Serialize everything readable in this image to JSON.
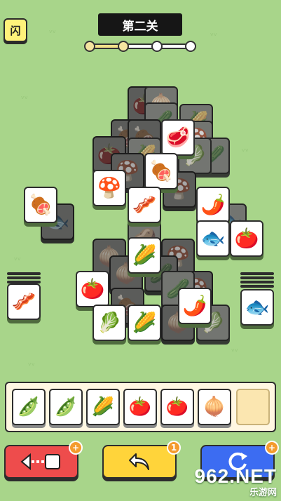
{
  "header": {
    "level_title": "第二关",
    "hint_label": "闪",
    "progress_steps_done": 2,
    "progress_steps_total": 4
  },
  "tiles": {
    "active": [
      {
        "id": "meat-top",
        "icon": "🥩",
        "name": "meat"
      },
      {
        "id": "ham-top",
        "icon": "🍖",
        "name": "ham"
      },
      {
        "id": "mushroom",
        "icon": "🍄",
        "name": "mushroom"
      },
      {
        "id": "ham-left",
        "icon": "🍖",
        "name": "ham"
      },
      {
        "id": "meat-center",
        "icon": "🥓",
        "name": "bacon"
      },
      {
        "id": "chili-right",
        "icon": "🌶️",
        "name": "chili"
      },
      {
        "id": "fish-center",
        "icon": "🐟",
        "name": "fish"
      },
      {
        "id": "tomato-right",
        "icon": "🍅",
        "name": "tomato"
      },
      {
        "id": "bamboo-center",
        "icon": "🌽",
        "name": "bamboo-shoot"
      },
      {
        "id": "tomato-left",
        "icon": "🍅",
        "name": "tomato"
      },
      {
        "id": "chili-bottom",
        "icon": "🌶️",
        "name": "chili"
      },
      {
        "id": "celery",
        "icon": "🥬",
        "name": "celery"
      },
      {
        "id": "bamboo-bottom",
        "icon": "🌽",
        "name": "bamboo-shoot"
      },
      {
        "id": "bacon-left-stack",
        "icon": "🥓",
        "name": "bacon"
      },
      {
        "id": "fish-right-stack",
        "icon": "🐟",
        "name": "fish"
      }
    ]
  },
  "tray": {
    "slots": [
      {
        "icon": "🫛",
        "name": "edamame"
      },
      {
        "icon": "🫛",
        "name": "edamame"
      },
      {
        "icon": "🌽",
        "name": "bamboo-shoot"
      },
      {
        "icon": "🍅",
        "name": "tomato"
      },
      {
        "icon": "🍅",
        "name": "tomato"
      },
      {
        "icon": "🧅",
        "name": "onion"
      },
      {
        "icon": "",
        "name": "empty"
      }
    ]
  },
  "tools": {
    "undo_badge": "1",
    "remove_badge": "+",
    "shuffle_badge": "+"
  },
  "watermark": {
    "number": "962.NET",
    "subtitle": "乐游网"
  },
  "colors": {
    "background": "#a8d58a",
    "remove_btn": "#ee4c4c",
    "undo_btn": "#ffd43a",
    "shuffle_btn": "#3c6cf2",
    "tray_bg": "#fff7e2"
  }
}
